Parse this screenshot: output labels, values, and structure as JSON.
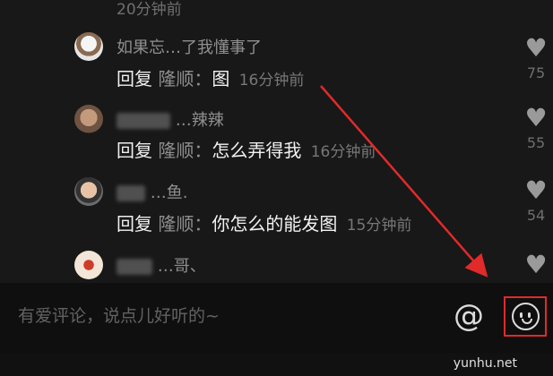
{
  "top_timestamp": "20分钟前",
  "replies": [
    {
      "username": "如果忘…了我懂事了",
      "reply_prefix": "回复",
      "reply_to": "隆顺：",
      "message": "图",
      "time": "16分钟前",
      "likes": "75",
      "avatar_icon": "avatar-icon"
    },
    {
      "username": "…辣辣",
      "reply_prefix": "回复",
      "reply_to": "隆顺：",
      "message": "怎么弄得我",
      "time": "16分钟前",
      "likes": "55",
      "avatar_icon": "avatar-icon"
    },
    {
      "username": "…鱼.",
      "reply_prefix": "回复",
      "reply_to": "隆顺：",
      "message": "你怎么的能发图",
      "time": "15分钟前",
      "likes": "54",
      "avatar_icon": "avatar-icon"
    },
    {
      "username": "…哥、",
      "reply_prefix": "",
      "reply_to": "",
      "message": "",
      "time": "",
      "likes": "",
      "avatar_icon": "avatar-icon"
    }
  ],
  "input": {
    "placeholder": "有爱评论，说点儿好听的~",
    "at_label": "@"
  },
  "watermark": "yunhu.net",
  "colors": {
    "highlight": "#e12a2a",
    "background": "#181818"
  }
}
